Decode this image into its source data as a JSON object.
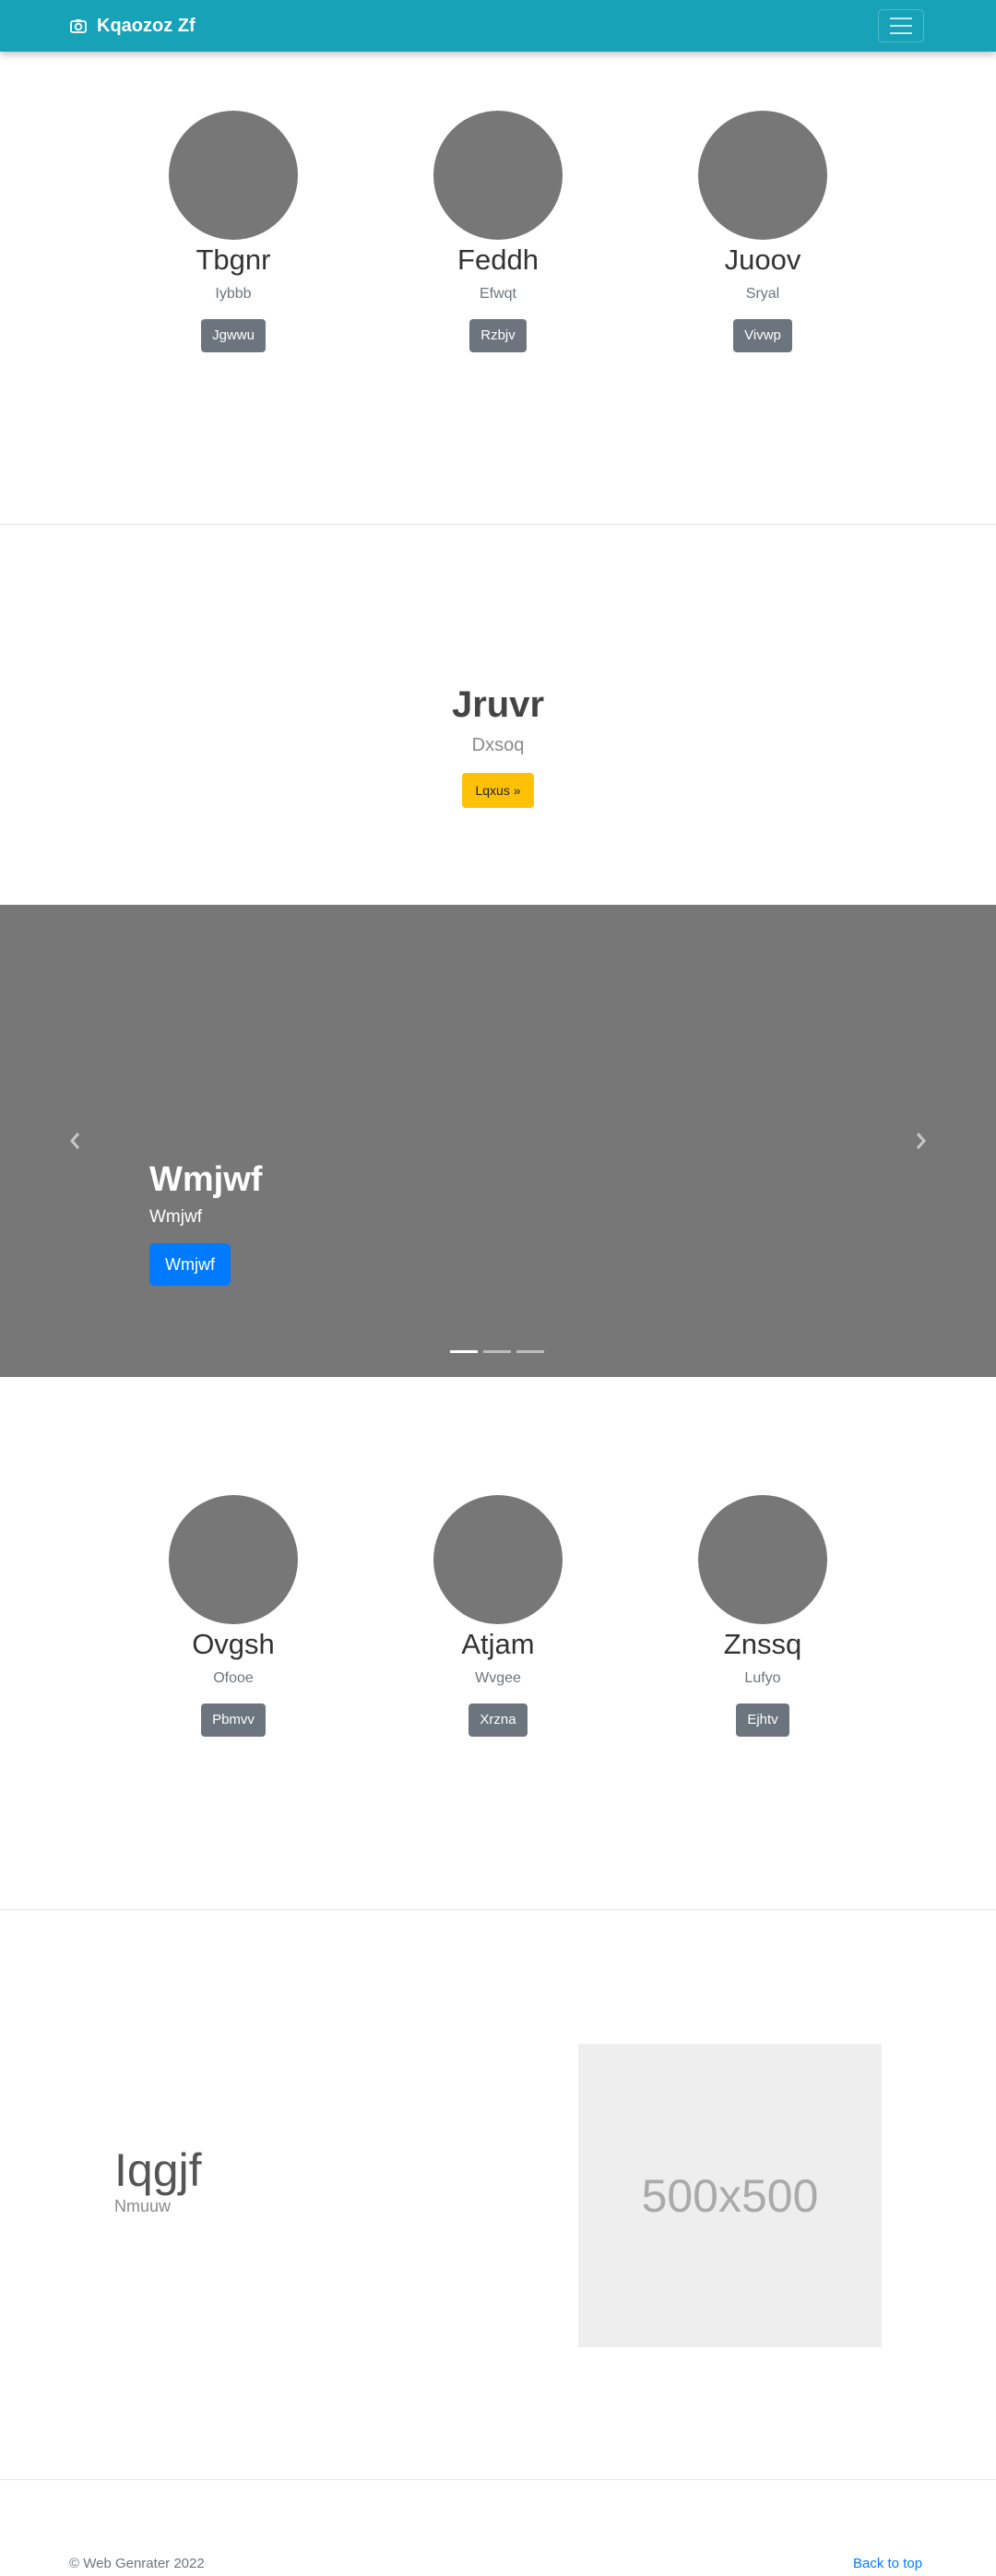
{
  "navbar": {
    "brand": "Kqaozoz Zf",
    "brand_icon": "camera-icon",
    "toggler_icon": "hamburger-menu-icon",
    "color": "#17a2b8"
  },
  "team_top": [
    {
      "name": "Tbgnr",
      "subtitle": "Iybbb",
      "button": "Jgwwu"
    },
    {
      "name": "Feddh",
      "subtitle": "Efwqt",
      "button": "Rzbjv"
    },
    {
      "name": "Juoov",
      "subtitle": "Sryal",
      "button": "Vivwp"
    }
  ],
  "hero": {
    "title": "Jruvr",
    "subtitle": "Dxsoq",
    "button": "Lqxus »",
    "button_color": "#ffc107"
  },
  "carousel": {
    "title": "Wmjwf",
    "subtitle": "Wmjwf",
    "button": "Wmjwf",
    "button_color": "#007bff",
    "slide_count": 3,
    "active_slide": 1,
    "prev_icon": "chevron-left-icon",
    "next_icon": "chevron-right-icon"
  },
  "team_bottom": [
    {
      "name": "Ovgsh",
      "subtitle": "Ofooe",
      "button": "Pbmvv"
    },
    {
      "name": "Atjam",
      "subtitle": "Wvgee",
      "button": "Xrzna"
    },
    {
      "name": "Znssq",
      "subtitle": "Lufyo",
      "button": "Ejhtv"
    }
  ],
  "feature": {
    "title": "Iqgjf",
    "subtitle": "Nmuuw",
    "image_label": "500x500"
  },
  "footer": {
    "copyright": "© Web Genrater 2022",
    "back_to_top": "Back to top"
  }
}
